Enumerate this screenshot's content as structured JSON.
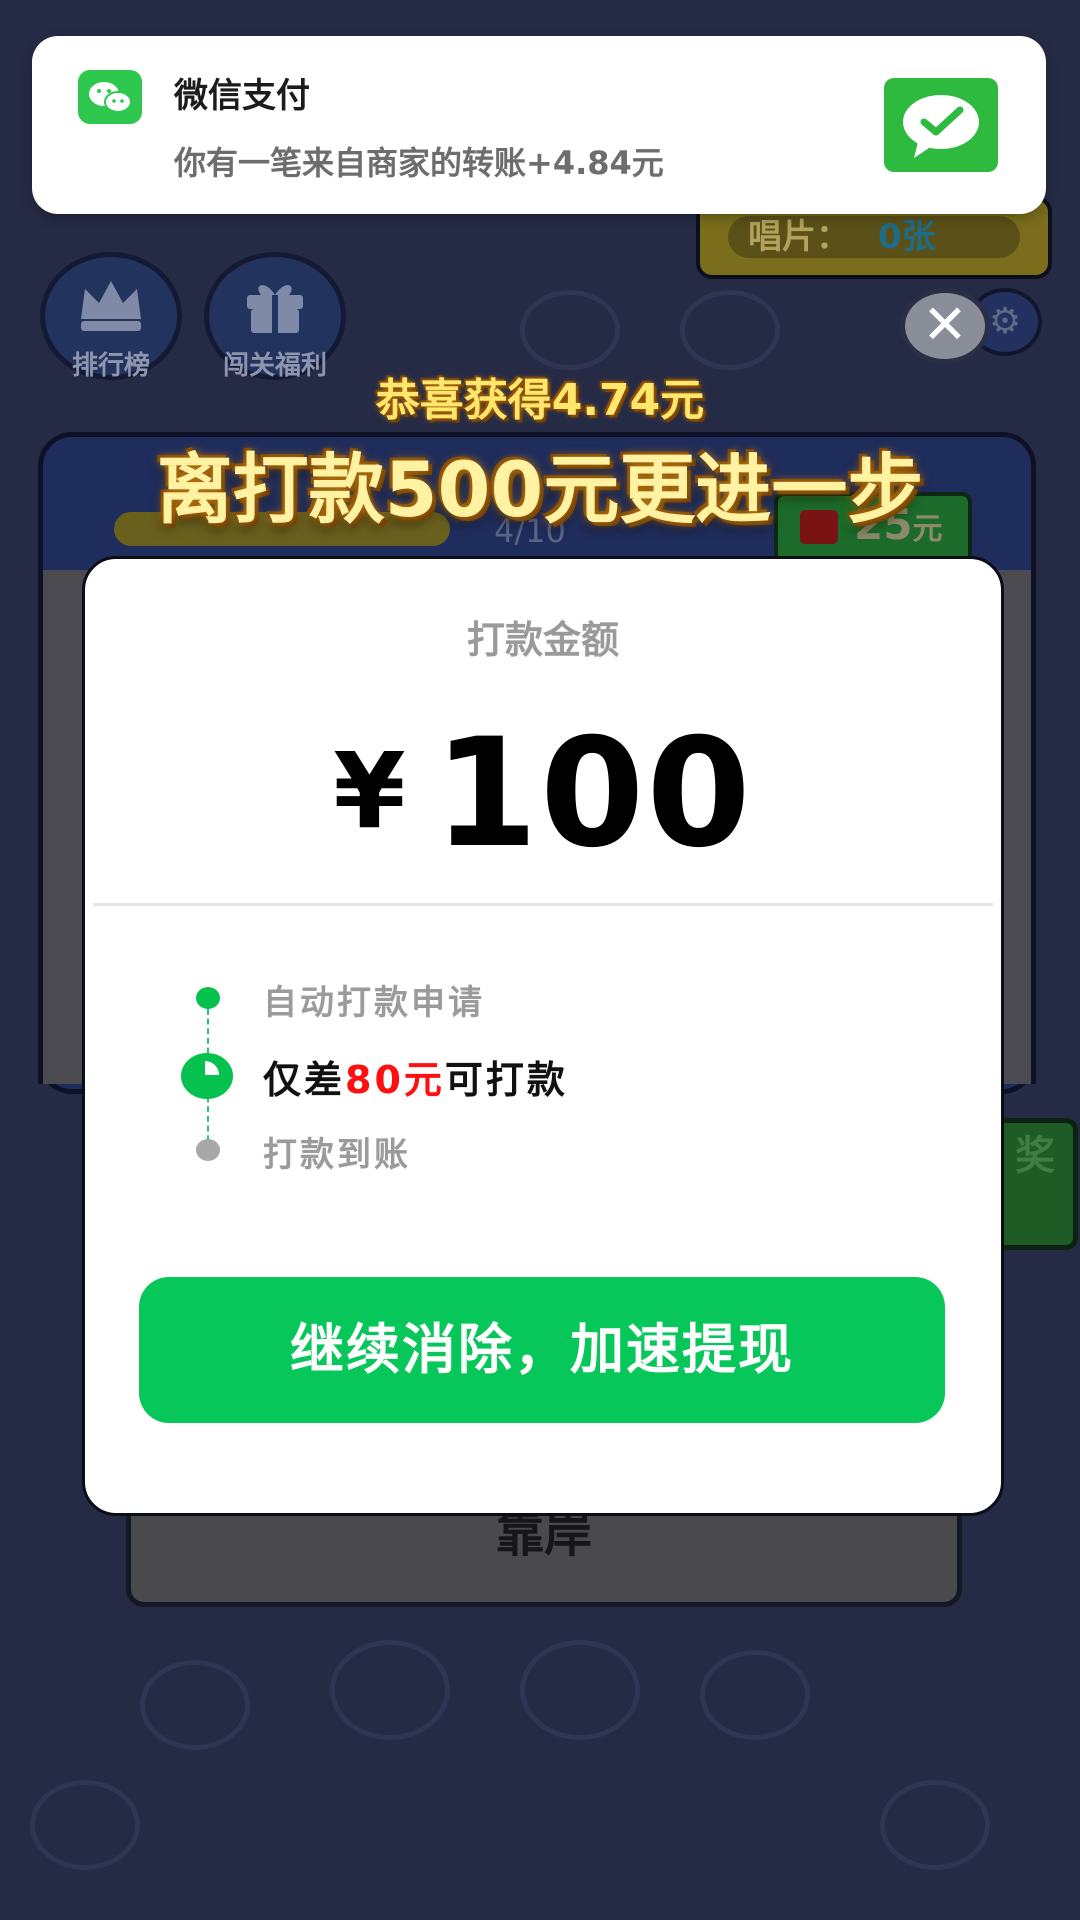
{
  "notification": {
    "app_name": "微信支付",
    "message": "你有一笔来自商家的转账+4.84元"
  },
  "background": {
    "disc_label": "唱片：",
    "disc_count": "0张",
    "leaderboard_label": "排行榜",
    "level_rewards_label": "闯关福利",
    "progress_text": "4/10",
    "progress_fraction": 0.4,
    "reward_amount": "25",
    "reward_unit": "元",
    "side_button_label": "奖",
    "bottom_button_label": "靠岸"
  },
  "banner": {
    "subtitle": "恭喜获得4.74元",
    "title": "离打款500元更进一步"
  },
  "dialog": {
    "label": "打款金额",
    "currency": "¥",
    "amount": "100",
    "steps": [
      {
        "text": "自动打款申请",
        "status": "done"
      },
      {
        "prefix": "仅差",
        "highlight": "80元",
        "suffix": "可打款",
        "status": "current"
      },
      {
        "text": "打款到账",
        "status": "pending"
      }
    ],
    "cta_label": "继续消除，加速提现"
  },
  "colors": {
    "wechat_green": "#07c75a",
    "highlight_red": "#ff1010",
    "banner_gold": "#fff2a3",
    "background": "#262b45"
  },
  "icons": {
    "notification_app": "wechat-icon",
    "notification_large": "wechat-pay-icon",
    "close": "close-icon",
    "settings": "gear-icon",
    "leaderboard": "crown-icon",
    "rewards": "gift-icon"
  }
}
